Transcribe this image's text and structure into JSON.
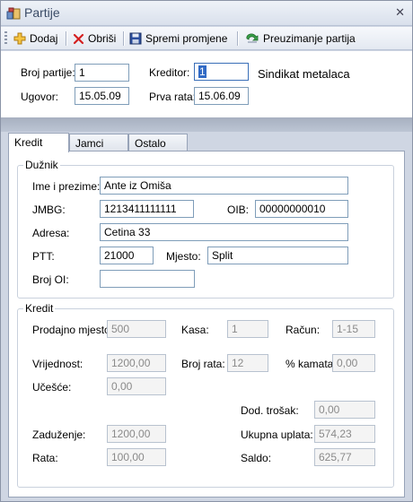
{
  "window": {
    "title": "Partije",
    "close_symbol": "✕"
  },
  "toolbar": {
    "add_label": "Dodaj",
    "delete_label": "Obriši",
    "save_label": "Spremi promjene",
    "import_label": "Preuzimanje partija"
  },
  "header": {
    "broj_partije_label": "Broj partije:",
    "broj_partije_value": "1",
    "ugovor_label": "Ugovor:",
    "ugovor_value": "15.05.09",
    "kreditor_label": "Kreditor:",
    "kreditor_value": "1",
    "kreditor_name": "Sindikat metalaca",
    "prva_rata_label": "Prva rata:",
    "prva_rata_value": "15.06.09"
  },
  "tabs": [
    {
      "label": "Kredit",
      "active": true
    },
    {
      "label": "Jamci",
      "active": false
    },
    {
      "label": "Ostalo",
      "active": false
    }
  ],
  "duznik": {
    "title": "Dužnik",
    "ime_label": "Ime i prezime:",
    "ime_value": "Ante iz Omiša",
    "jmbg_label": "JMBG:",
    "jmbg_value": "1213411111111",
    "oib_label": "OIB:",
    "oib_value": "00000000010",
    "adresa_label": "Adresa:",
    "adresa_value": "Cetina 33",
    "ptt_label": "PTT:",
    "ptt_value": "21000",
    "mjesto_label": "Mjesto:",
    "mjesto_value": "Split",
    "broj_oi_label": "Broj OI:",
    "broj_oi_value": ""
  },
  "kredit": {
    "title": "Kredit",
    "prodajno_label": "Prodajno mjesto:",
    "prodajno_value": "500",
    "kasa_label": "Kasa:",
    "kasa_value": "1",
    "racun_label": "Račun:",
    "racun_value": "1-15",
    "vrijednost_label": "Vrijednost:",
    "vrijednost_value": "1200,00",
    "broj_rata_label": "Broj rata:",
    "broj_rata_value": "12",
    "kamata_label": "% kamata:",
    "kamata_value": "0,00",
    "ucesce_label": "Učešće:",
    "ucesce_value": "0,00",
    "dod_trosak_label": "Dod. trošak:",
    "dod_trosak_value": "0,00",
    "zaduzenje_label": "Zaduženje:",
    "zaduzenje_value": "1200,00",
    "ukupna_label": "Ukupna uplata:",
    "ukupna_value": "574,23",
    "rata_label": "Rata:",
    "rata_value": "100,00",
    "saldo_label": "Saldo:",
    "saldo_value": "625,77"
  }
}
